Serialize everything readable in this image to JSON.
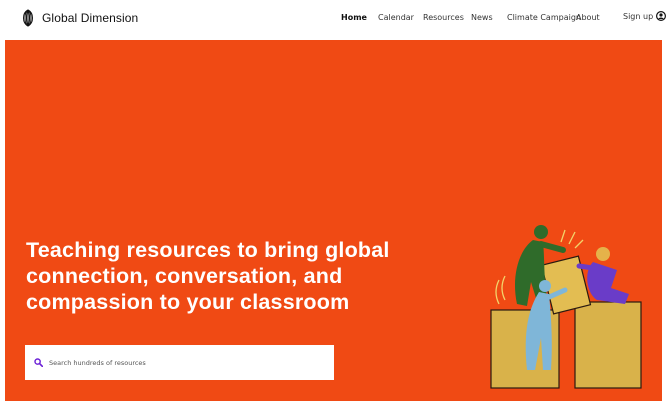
{
  "brand": {
    "name": "Global Dimension",
    "logo_icon": "globe-lines-icon"
  },
  "nav": {
    "items": [
      {
        "label": "Home",
        "active": true
      },
      {
        "label": "Calendar",
        "active": false
      },
      {
        "label": "Resources",
        "active": false
      },
      {
        "label": "News",
        "active": false
      },
      {
        "label": "Climate Campaign",
        "active": false
      },
      {
        "label": "About",
        "active": false
      }
    ],
    "signup": {
      "label": "Sign up",
      "icon": "user-circle-icon"
    }
  },
  "hero": {
    "headline_lines": [
      "Teaching resources to bring global",
      "connection, conversation, and",
      "compassion to your classroom"
    ],
    "background_color": "#f04a14",
    "illustration": "people-stacking-blocks-illustration"
  },
  "search": {
    "placeholder": "Search hundreds of resources",
    "icon": "search-icon",
    "accent_color": "#6a1fd6"
  }
}
